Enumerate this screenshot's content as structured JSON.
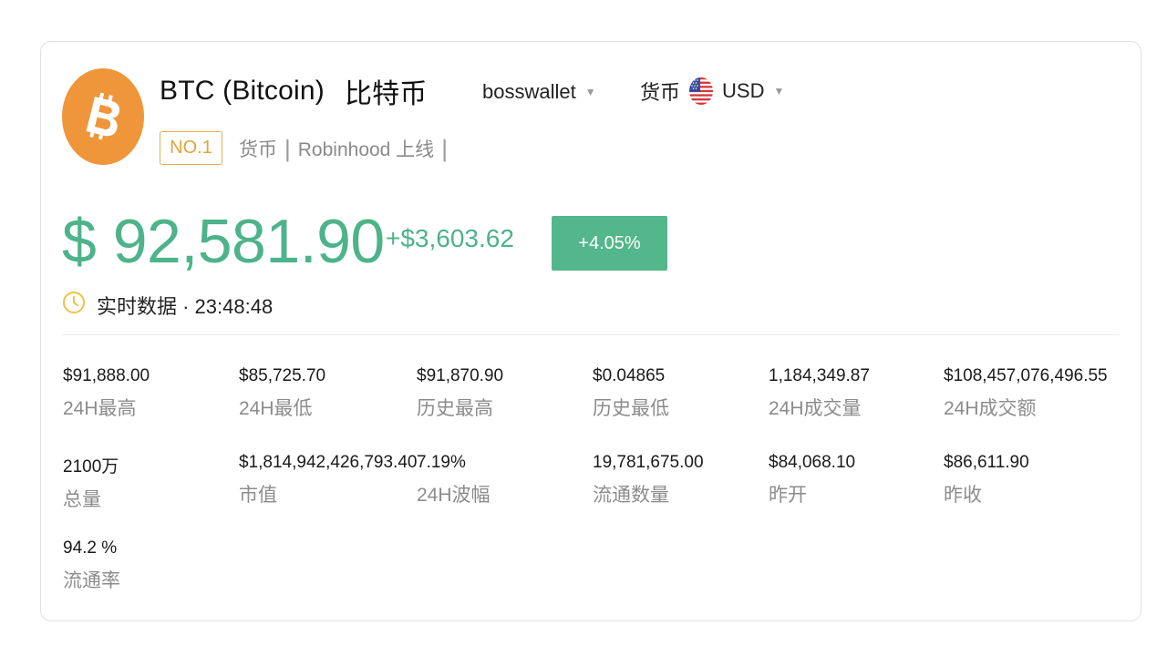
{
  "coin": {
    "symbol_name": "BTC (Bitcoin)",
    "name_cn": "比特币",
    "logo_icon": "bitcoin-icon",
    "logo_color": "#f0963a",
    "rank": "NO.1",
    "tags": [
      "货币",
      "Robinhood 上线"
    ]
  },
  "wallet_select": {
    "value": "bosswallet"
  },
  "currency_select": {
    "label": "货币",
    "flag_icon": "us-flag-icon",
    "value": "USD"
  },
  "price": {
    "value": "$ 92,581.90",
    "change_abs": "+$3,603.62",
    "change_pct": "+4.05%",
    "up_color": "#4db38a"
  },
  "realtime": {
    "label": "实时数据 · 23:48:48"
  },
  "stats": [
    {
      "value": "$91,888.00",
      "label": "24H最高"
    },
    {
      "value": "$85,725.70",
      "label": "24H最低"
    },
    {
      "value": "$91,870.90",
      "label": "历史最高"
    },
    {
      "value": "$0.04865",
      "label": "历史最低"
    },
    {
      "value": "1,184,349.87",
      "label": "24H成交量"
    },
    {
      "value": "$108,457,076,496.55",
      "label": "24H成交额"
    },
    {
      "value": "2100万",
      "label": "总量"
    },
    {
      "value": "$1,814,942,426,793.40",
      "label": "市值"
    },
    {
      "value": "7.19%",
      "label": "24H波幅"
    },
    {
      "value": "19,781,675.00",
      "label": "流通数量"
    },
    {
      "value": "$84,068.10",
      "label": "昨开"
    },
    {
      "value": "$86,611.90",
      "label": "昨收"
    },
    {
      "value": "94.2 %",
      "label": "流通率"
    }
  ]
}
